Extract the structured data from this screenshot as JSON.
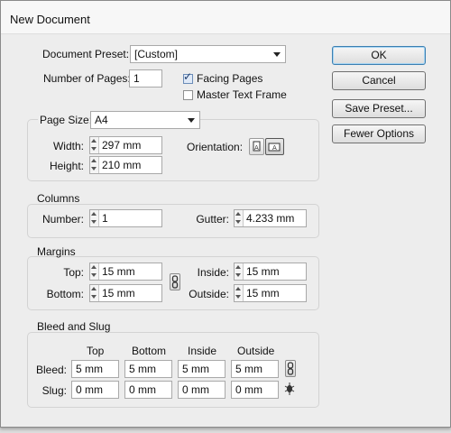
{
  "window": {
    "title": "New Document"
  },
  "document_preset": {
    "label": "Document Preset:",
    "value": "[Custom]"
  },
  "pages": {
    "label": "Number of Pages:",
    "value": "1"
  },
  "facing_pages": {
    "label": "Facing Pages",
    "checked": true
  },
  "master_text_frame": {
    "label": "Master Text Frame",
    "checked": false
  },
  "page_size": {
    "label": "Page Size:",
    "value": "A4"
  },
  "width": {
    "label": "Width:",
    "value": "297 mm"
  },
  "height": {
    "label": "Height:",
    "value": "210 mm"
  },
  "orientation": {
    "label": "Orientation:",
    "selected": "landscape"
  },
  "columns": {
    "title": "Columns",
    "number_label": "Number:",
    "number_value": "1",
    "gutter_label": "Gutter:",
    "gutter_value": "4.233 mm"
  },
  "margins": {
    "title": "Margins",
    "top_label": "Top:",
    "top_value": "15 mm",
    "bottom_label": "Bottom:",
    "bottom_value": "15 mm",
    "inside_label": "Inside:",
    "inside_value": "15 mm",
    "outside_label": "Outside:",
    "outside_value": "15 mm"
  },
  "bleed_slug": {
    "title": "Bleed and Slug",
    "headers": [
      "Top",
      "Bottom",
      "Inside",
      "Outside"
    ],
    "bleed_label": "Bleed:",
    "bleed_values": [
      "5 mm",
      "5 mm",
      "5 mm",
      "5 mm"
    ],
    "slug_label": "Slug:",
    "slug_values": [
      "0 mm",
      "0 mm",
      "0 mm",
      "0 mm"
    ]
  },
  "buttons": {
    "ok": "OK",
    "cancel": "Cancel",
    "save_preset": "Save Preset...",
    "fewer_options": "Fewer Options"
  }
}
